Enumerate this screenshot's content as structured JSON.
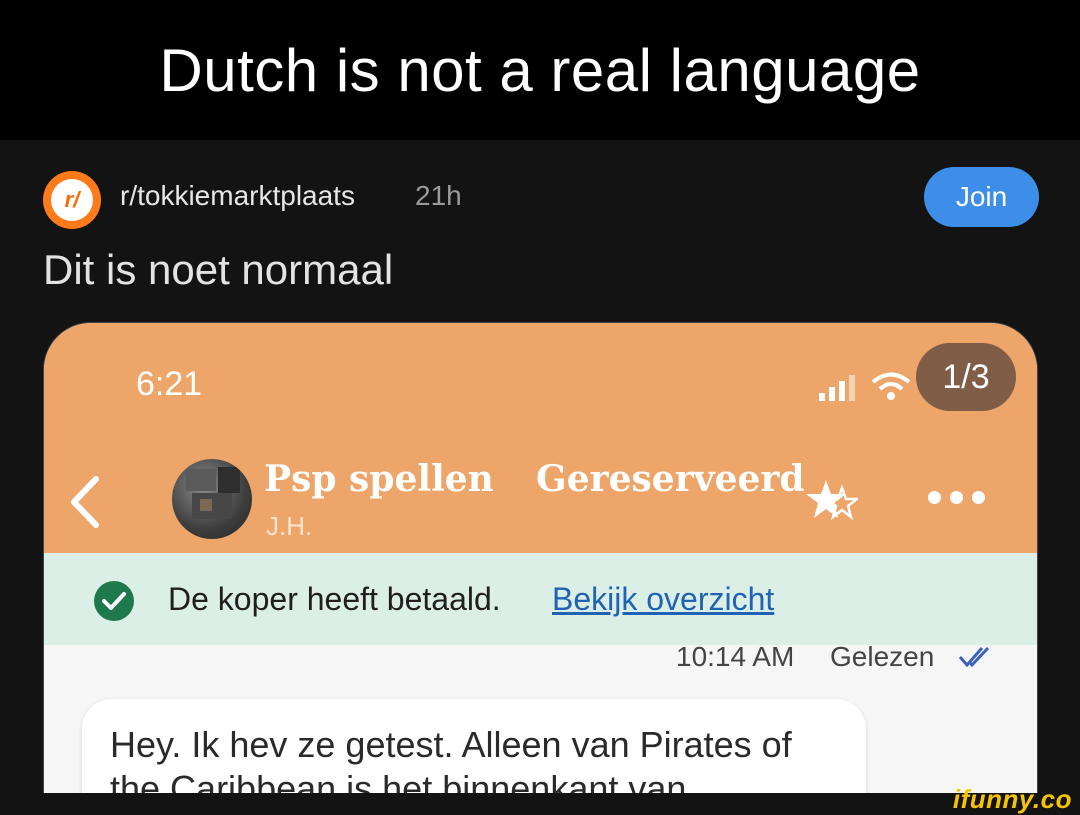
{
  "caption": "Dutch is not a real language",
  "post": {
    "subreddit": "r/tokkiemarktplaats",
    "icon_text": "r/",
    "age": "21h",
    "join_label": "Join",
    "title": "Dit is noet normaal"
  },
  "screenshot": {
    "time": "6:21",
    "image_counter": "1/3",
    "listing_title": "Psp spellen",
    "listing_status": "Gereserveerd",
    "seller": "J.H.",
    "paid_text": "De koper heeft betaald.",
    "paid_link": "Bekijk overzicht",
    "msg_time": "10:14 AM",
    "msg_read": "Gelezen",
    "message": "Hey. Ik hev ze getest. Alleen van Pirates of the Caribbean is het binnenkant van"
  },
  "watermark": "ifunny.co",
  "colors": {
    "header_orange": "#eda56a",
    "join_blue": "#3d8ee8",
    "paid_green": "#1e7a4d",
    "banner_mint": "#dcefe6"
  }
}
